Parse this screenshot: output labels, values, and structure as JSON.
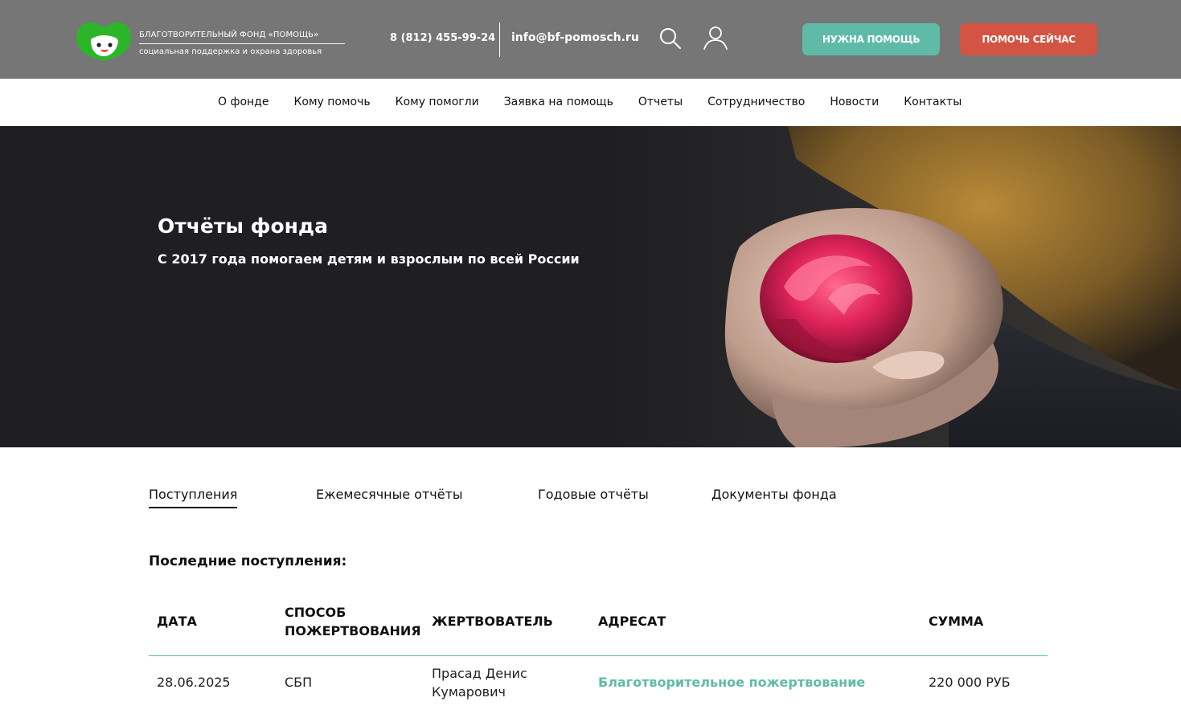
{
  "header": {
    "brand_name": "БЛАГОТВОРИТЕЛЬНЫЙ ФОНД «ПОМОЩЬ»",
    "brand_sub": "социальная поддержка и охрана здоровья",
    "phone": "8 (812) 455-99-24",
    "email": "info@bf-pomosch.ru",
    "btn_need_help": "НУЖНА ПОМОЩЬ",
    "btn_help_now": "ПОМОЧЬ СЕЙЧАС",
    "colors": {
      "topbar": "#767676",
      "logo": "#2db52a",
      "btn_need": "#5fbba8",
      "btn_help": "#d35443"
    }
  },
  "nav": {
    "items": [
      "О фонде",
      "Кому помочь",
      "Кому помогли",
      "Заявка на помощь",
      "Отчеты",
      "Сотрудничество",
      "Новости",
      "Контакты"
    ]
  },
  "hero": {
    "title": "Отчёты фонда",
    "subtitle": "С 2017 года помогаем детям и взрослым по всей России"
  },
  "tabs": [
    {
      "label": "Поступления",
      "active": true
    },
    {
      "label": "Ежемесячные отчёты",
      "active": false
    },
    {
      "label": "Годовые отчёты",
      "active": false
    },
    {
      "label": "Документы фонда",
      "active": false
    }
  ],
  "section": {
    "title": "Последние поступления:"
  },
  "table": {
    "columns": [
      "ДАТА",
      "СПОСОБ ПОЖЕРТВОВАНИЯ",
      "ЖЕРТВОВАТЕЛЬ",
      "АДРЕСАТ",
      "СУММА"
    ],
    "rows": [
      {
        "date": "28.06.2025",
        "method": "СБП",
        "donor": "Прасад Денис Кумарович",
        "recipient": "Благотворительное пожертвование",
        "amount": "220 000 РУБ"
      }
    ]
  },
  "icons": {
    "search": "search-icon",
    "user": "user-icon",
    "logo": "heart-face-logo-icon"
  }
}
